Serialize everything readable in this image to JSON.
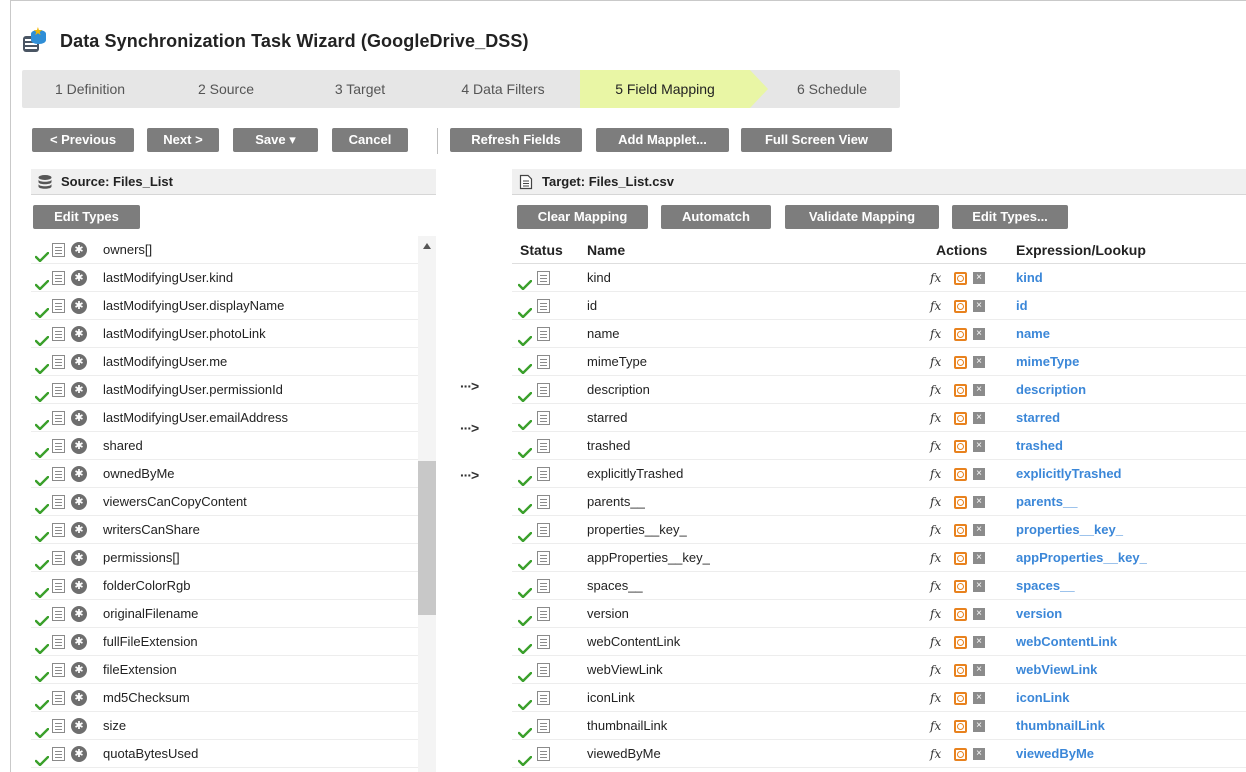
{
  "window": {
    "title": "Data Synchronization Task Wizard (GoogleDrive_DSS)"
  },
  "steps": [
    {
      "label": "1 Definition",
      "active": false
    },
    {
      "label": "2 Source",
      "active": false
    },
    {
      "label": "3 Target",
      "active": false
    },
    {
      "label": "4 Data Filters",
      "active": false
    },
    {
      "label": "5 Field Mapping",
      "active": true
    },
    {
      "label": "6 Schedule",
      "active": false
    }
  ],
  "toolbar": {
    "previous": "< Previous",
    "next": "Next >",
    "save": "Save ▾",
    "cancel": "Cancel",
    "refresh": "Refresh Fields",
    "add_mapplet": "Add Mapplet...",
    "full_screen": "Full Screen View"
  },
  "source": {
    "title": "Source: Files_List",
    "edit_types": "Edit Types",
    "fields": [
      "owners[]",
      "lastModifyingUser.kind",
      "lastModifyingUser.displayName",
      "lastModifyingUser.photoLink",
      "lastModifyingUser.me",
      "lastModifyingUser.permissionId",
      "lastModifyingUser.emailAddress",
      "shared",
      "ownedByMe",
      "viewersCanCopyContent",
      "writersCanShare",
      "permissions[]",
      "folderColorRgb",
      "originalFilename",
      "fullFileExtension",
      "fileExtension",
      "md5Checksum",
      "size",
      "quotaBytesUsed"
    ]
  },
  "target": {
    "title": "Target: Files_List.csv",
    "clear_mapping": "Clear Mapping",
    "automatch": "Automatch",
    "validate_mapping": "Validate Mapping",
    "edit_types": "Edit Types...",
    "columns": {
      "status": "Status",
      "name": "Name",
      "actions": "Actions",
      "expression": "Expression/Lookup"
    },
    "fx_label": "fx",
    "rows": [
      {
        "name": "kind",
        "expr": "kind"
      },
      {
        "name": "id",
        "expr": "id"
      },
      {
        "name": "name",
        "expr": "name"
      },
      {
        "name": "mimeType",
        "expr": "mimeType"
      },
      {
        "name": "description",
        "expr": "description"
      },
      {
        "name": "starred",
        "expr": "starred"
      },
      {
        "name": "trashed",
        "expr": "trashed"
      },
      {
        "name": "explicitlyTrashed",
        "expr": "explicitlyTrashed"
      },
      {
        "name": "parents__",
        "expr": "parents__"
      },
      {
        "name": "properties__key_",
        "expr": "properties__key_"
      },
      {
        "name": "appProperties__key_",
        "expr": "appProperties__key_"
      },
      {
        "name": "spaces__",
        "expr": "spaces__"
      },
      {
        "name": "version",
        "expr": "version"
      },
      {
        "name": "webContentLink",
        "expr": "webContentLink"
      },
      {
        "name": "webViewLink",
        "expr": "webViewLink"
      },
      {
        "name": "iconLink",
        "expr": "iconLink"
      },
      {
        "name": "thumbnailLink",
        "expr": "thumbnailLink"
      },
      {
        "name": "viewedByMe",
        "expr": "viewedByMe"
      }
    ]
  },
  "mapping_arrow": "···>",
  "icons": {
    "status_ok": "check-icon",
    "field_props": "document-icon",
    "field_star": "star-icon",
    "expression": "fx-icon",
    "lookup": "lookup-icon",
    "clear": "clear-icon"
  },
  "colors": {
    "active_step": "#e9f6a5",
    "button": "#7d7d7d",
    "check": "#3aa02b",
    "expression_text": "#3b87d8",
    "lookup": "#e8821e"
  }
}
